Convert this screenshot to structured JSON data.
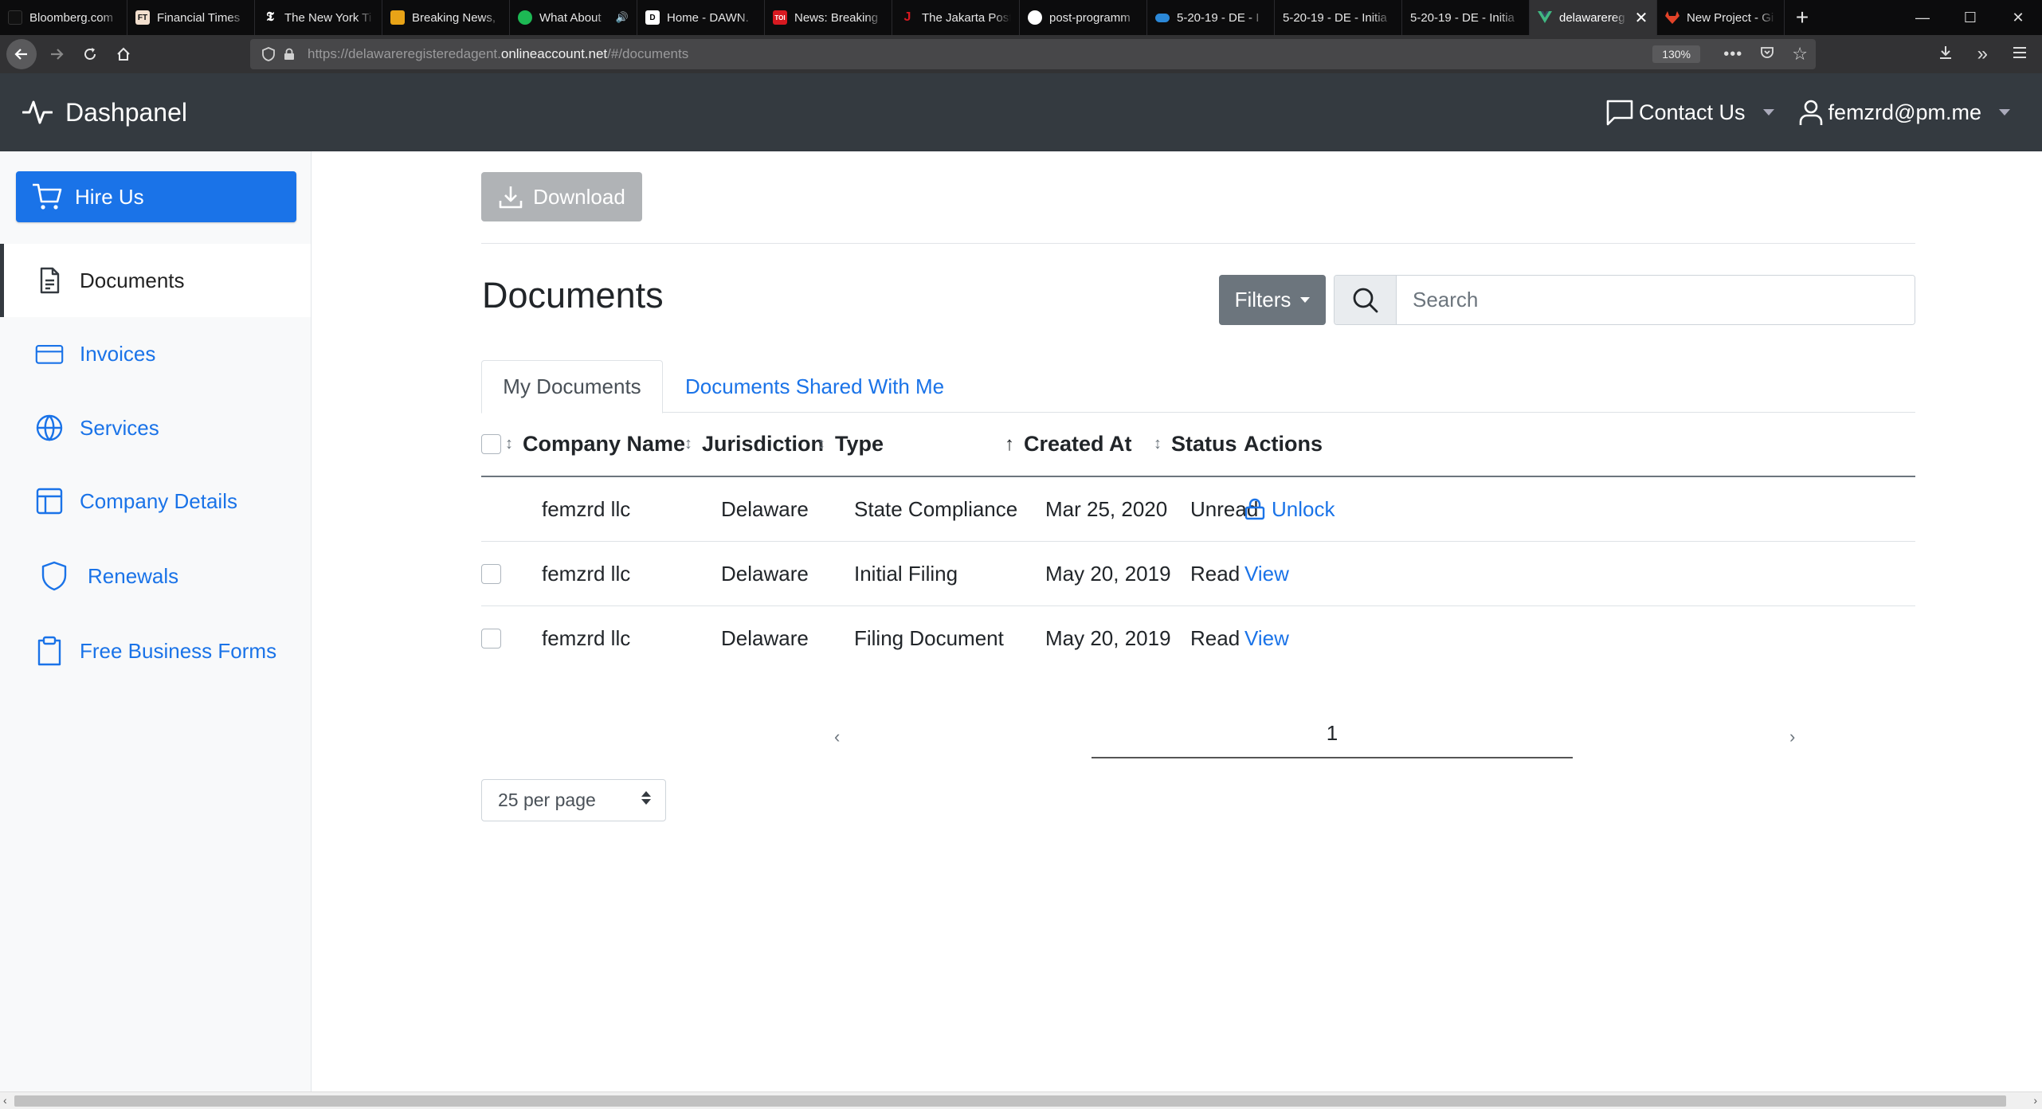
{
  "browser": {
    "tabs": [
      {
        "label": "Bloomberg.com",
        "icon": "bloomberg-icon",
        "color": "#000000"
      },
      {
        "label": "Financial Times",
        "icon": "ft-icon",
        "color": "#f2dfce"
      },
      {
        "label": "The New York Ti",
        "icon": "nyt-icon",
        "color": "#000000"
      },
      {
        "label": "Breaking News,",
        "icon": "news-icon",
        "color": "#e8a317"
      },
      {
        "label": "What About",
        "icon": "spotify-icon",
        "color": "#1db954"
      },
      {
        "label": "Home - DAWN.",
        "icon": "dawn-icon",
        "color": "#ffffff"
      },
      {
        "label": "News: Breaking",
        "icon": "toi-icon",
        "color": "#d71920"
      },
      {
        "label": "The Jakarta Post",
        "icon": "jakarta-icon",
        "color": "#d71920"
      },
      {
        "label": "post-programm",
        "icon": "github-icon",
        "color": "#ffffff"
      },
      {
        "label": "5-20-19 - DE - I",
        "icon": "onedrive-icon",
        "color": "#2b88d8"
      },
      {
        "label": "5-20-19 - DE - Initia",
        "icon": "",
        "color": ""
      },
      {
        "label": "5-20-19 - DE - Initia",
        "icon": "",
        "color": ""
      },
      {
        "label": "delawarereg",
        "icon": "vue-icon",
        "color": "#41b883"
      },
      {
        "label": "New Project - Gi",
        "icon": "gitlab-icon",
        "color": "#e24329"
      }
    ],
    "tab_letters": {
      "ft": "FT",
      "dawn": "D",
      "toi": "TOI",
      "jakarta": "J"
    },
    "url_prefix": "https://delawareregisteredagent.",
    "url_domain": "onlineaccount.net",
    "url_suffix": "/#/documents",
    "zoom": "130%"
  },
  "app": {
    "brand": "Dashpanel",
    "contact": "Contact Us",
    "user": "femzrd@pm.me"
  },
  "sidebar": {
    "hire": "Hire Us",
    "items": [
      {
        "label": "Documents",
        "icon": "document-icon"
      },
      {
        "label": "Invoices",
        "icon": "credit-card-icon"
      },
      {
        "label": "Services",
        "icon": "globe-icon"
      },
      {
        "label": "Company Details",
        "icon": "layout-icon"
      },
      {
        "label": "Renewals",
        "icon": "shield-icon"
      },
      {
        "label": "Free Business Forms",
        "icon": "clipboard-icon"
      }
    ]
  },
  "main": {
    "download": "Download",
    "title": "Documents",
    "filters": "Filters",
    "search_placeholder": "Search",
    "tabs": [
      "My Documents",
      "Documents Shared With Me"
    ],
    "columns": [
      "Company Name",
      "Jurisdiction",
      "Type",
      "Created At",
      "Status",
      "Actions"
    ],
    "rows": [
      {
        "company": "femzrd llc",
        "jurisdiction": "Delaware",
        "type": "State Compliance",
        "created": "Mar 25, 2020",
        "status": "Unread",
        "action": "Unlock"
      },
      {
        "company": "femzrd llc",
        "jurisdiction": "Delaware",
        "type": "Initial Filing",
        "created": "May 20, 2019",
        "status": "Read",
        "action": "View"
      },
      {
        "company": "femzrd llc",
        "jurisdiction": "Delaware",
        "type": "Filing Document",
        "created": "May 20, 2019",
        "status": "Read",
        "action": "View"
      }
    ],
    "pager": {
      "prev": "‹",
      "page": "1",
      "next": "›"
    },
    "per_page": "25 per page"
  },
  "colors": {
    "accent": "#1a73e8",
    "header_bg": "#343a40",
    "filters_bg": "#6c757d",
    "download_disabled": "#b0b3b6"
  }
}
